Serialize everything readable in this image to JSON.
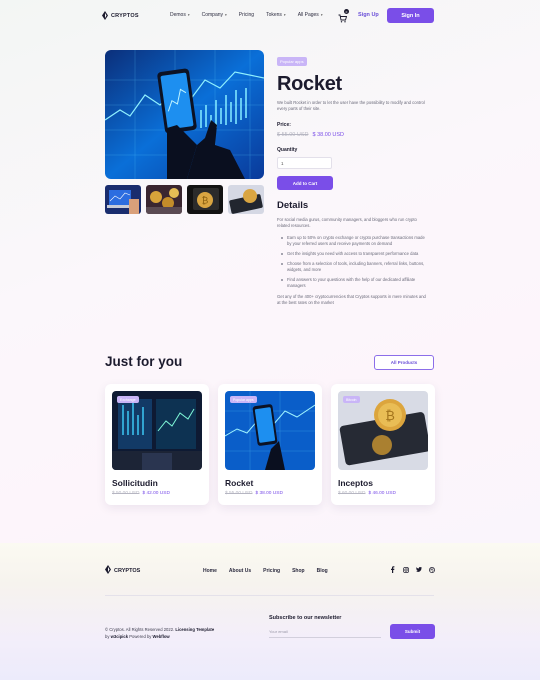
{
  "brand": {
    "name": "CRYPTOS"
  },
  "nav": {
    "links": [
      "Demos",
      "Company",
      "Pricing",
      "Tokens",
      "All Pages"
    ],
    "cart_count": "0",
    "signup_label": "Sign Up",
    "signin_label": "Sign In"
  },
  "product": {
    "badge": "Popular apps",
    "title": "Rocket",
    "description": "We built Rocket in order to let the user have the possibility to modify and control every parts of their site.",
    "price_label": "Price:",
    "old_price": "$ 55.00 USD",
    "new_price": "$ 38.00 USD",
    "quantity_label": "Quantity",
    "quantity_value": "1",
    "add_to_cart_label": "Add to Cart",
    "details_title": "Details",
    "details_intro": "For social media gurus, community managers, and bloggers who run crypto related resources.",
    "bullets": [
      "Earn up to 50% on crypto exchange or crypto purchase transactions made by your referred users and receive payments on demand",
      "Get the insights you need with access to transparent performance data",
      "Choose from a selection of tools, including banners, referral links, buttons, widgets, and more",
      "Find answers to your questions with the help of our dedicated affiliate managers"
    ],
    "details_outro": "Get any of the 400+ cryptocurrencies that Cryptos supports in mere minutes and at the best rates on the market"
  },
  "just_for_you": {
    "title": "Just for you",
    "all_products_label": "All Products",
    "cards": [
      {
        "badge": "Exchange",
        "title": "Sollicitudin",
        "old_price": "$ 50.00 USD",
        "new_price": "$ 42.00 USD"
      },
      {
        "badge": "Popular apps",
        "title": "Rocket",
        "old_price": "$ 55.00 USD",
        "new_price": "$ 38.00 USD"
      },
      {
        "badge": "Bitcoin",
        "title": "Inceptos",
        "old_price": "$ 60.00 USD",
        "new_price": "$ 46.00 USD"
      }
    ]
  },
  "footer": {
    "links": [
      "Home",
      "About Us",
      "Pricing",
      "Shop",
      "Blog"
    ],
    "socials": [
      "facebook-icon",
      "instagram-icon",
      "twitter-icon",
      "dribbble-icon"
    ],
    "copyright_prefix": "© Cryptos. All Rights Reserved 2022.",
    "licensing": "Licensing",
    "template_label": "Template",
    "by_label": "by",
    "author": "w3cipick",
    "powered_label": "Powered by",
    "platform": "Webflow",
    "newsletter_title": "Subscribe to our newsletter",
    "email_placeholder": "Your email",
    "subscribe_label": "Submit"
  },
  "colors": {
    "accent": "#7a4ee8",
    "badge": "#c9b5f7",
    "text": "#1c1b2e"
  }
}
